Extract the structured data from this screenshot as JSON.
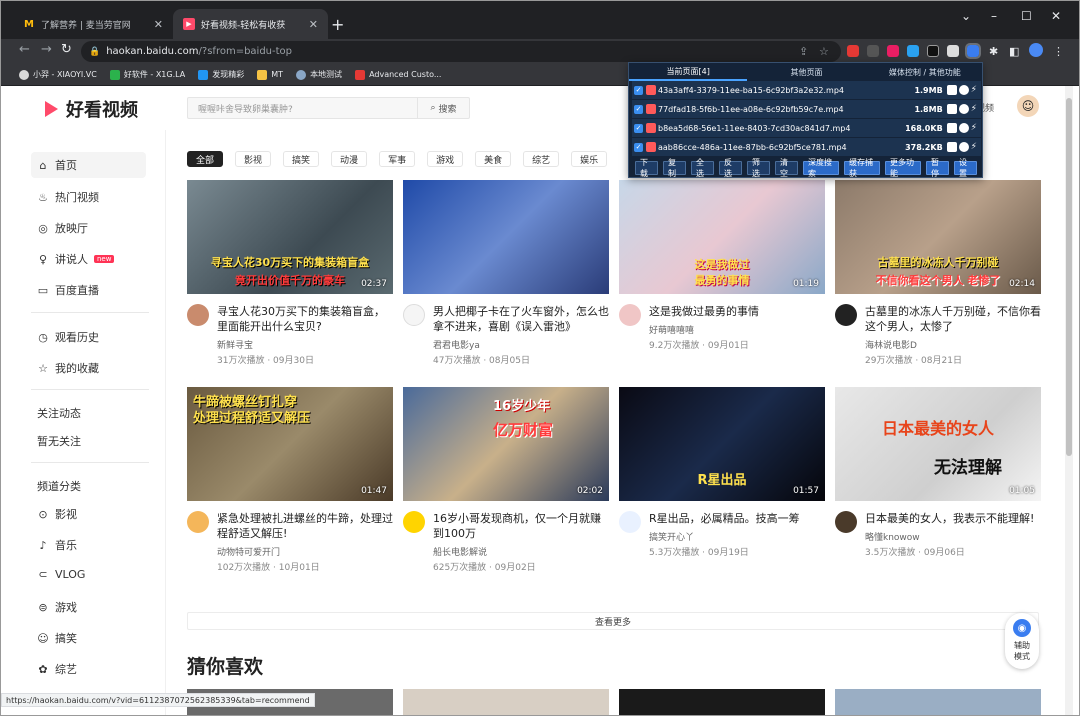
{
  "browser": {
    "tabs": [
      {
        "title": "了解营养 | 麦当劳官网",
        "active": false
      },
      {
        "title": "好看视频-轻松有收获",
        "active": true
      }
    ],
    "url_host": "haokan.baidu.com",
    "url_path": "/?sfrom=baidu-top",
    "bookmarks": [
      "小羿 - XIAOYI.VC",
      "好软件 - X1G.LA",
      "发现精彩",
      "MT",
      "本地测试",
      "Advanced Custo..."
    ]
  },
  "site": {
    "logo_text": "好看视频",
    "search_placeholder": "喔喔咔舍导致卵巢囊肿?",
    "search_button": "搜索",
    "header_video_label": "视频"
  },
  "sidebar": {
    "items": [
      {
        "label": "首页",
        "icon": "home-icon"
      },
      {
        "label": "热门视频",
        "icon": "fire-icon"
      },
      {
        "label": "放映厅",
        "icon": "theater-icon"
      },
      {
        "label": "讲说人",
        "icon": "mic-icon",
        "badge": "new"
      },
      {
        "label": "百度直播",
        "icon": "live-icon"
      },
      {
        "label": "观看历史",
        "icon": "clock-icon"
      },
      {
        "label": "我的收藏",
        "icon": "star-icon"
      },
      {
        "label": "关注动态"
      },
      {
        "label": "暂无关注"
      },
      {
        "label": "频道分类"
      },
      {
        "label": "影视",
        "icon": "play-circle-icon"
      },
      {
        "label": "音乐",
        "icon": "music-icon"
      },
      {
        "label": "VLOG",
        "icon": "vlog-icon"
      },
      {
        "label": "游戏",
        "icon": "gamepad-icon"
      },
      {
        "label": "搞笑",
        "icon": "smile-icon"
      },
      {
        "label": "综艺",
        "icon": "variety-icon"
      }
    ]
  },
  "categories": [
    "全部",
    "影视",
    "搞笑",
    "动漫",
    "军事",
    "游戏",
    "美食",
    "综艺",
    "娱乐"
  ],
  "videos": [
    {
      "title": "寻宝人花30万买下的集装箱盲盒，里面能开出什么宝贝?",
      "author": "新鲜寻宝",
      "meta": "31万次播放 · 09月30日",
      "duration": "02:37",
      "overlay1": "寻宝人花30万买下的集装箱盲盒",
      "overlay2": "竟开出价值千万的豪车"
    },
    {
      "title": "男人把椰子卡在了火车窗外，怎么也拿不进来，喜剧《误入雷池》",
      "author": "君君电影ya",
      "meta": "47万次播放 · 08月05日",
      "duration": "",
      "overlay1": "",
      "overlay2": ""
    },
    {
      "title": "这是我做过最勇的事情",
      "author": "好萌嘻嘻嘻",
      "meta": "9.2万次播放 · 09月01日",
      "duration": "01:19",
      "overlay1": "这是我做过",
      "overlay2": "最勇的事情"
    },
    {
      "title": "古墓里的冰冻人千万别碰，不信你看这个男人，太惨了",
      "author": "海林说电影D",
      "meta": "29万次播放 · 08月21日",
      "duration": "02:14",
      "overlay1": "古墓里的冰冻人千万别碰",
      "overlay2": "不信你看这个男人 老惨了"
    },
    {
      "title": "紧急处理被扎进螺丝的牛蹄，处理过程舒适又解压!",
      "author": "动物特可爱开门",
      "meta": "102万次播放 · 10月01日",
      "duration": "01:47",
      "overlay1": "牛蹄被螺丝钉扎穿",
      "overlay2": "处理过程舒适又解压"
    },
    {
      "title": "16岁小哥发现商机，仅一个月就赚到100万",
      "author": "船长电影解说",
      "meta": "625万次播放 · 09月02日",
      "duration": "02:02",
      "overlay1": "16岁少年",
      "overlay2": "亿万财富"
    },
    {
      "title": "R星出品，必属精品。技高一筹",
      "author": "搞笑开心丫",
      "meta": "5.3万次播放 · 09月19日",
      "duration": "01:57",
      "overlay1": "R星出品",
      "overlay2": ""
    },
    {
      "title": "日本最美的女人，我表示不能理解!",
      "author": "略懂knowow",
      "meta": "3.5万次播放 · 09月06日",
      "duration": "01:05",
      "overlay1": "日本最美的女人",
      "overlay2": "无法理解"
    }
  ],
  "load_more": "查看更多",
  "section_title": "猜你喜欢",
  "assist": {
    "line1": "辅助",
    "line2": "模式"
  },
  "statusbar": "https://haokan.baidu.com/v?vid=6112387072562385339&tab=recommend",
  "extension": {
    "tabs": [
      "当前页面[4]",
      "其他页面",
      "媒体控制 / 其他功能"
    ],
    "files": [
      {
        "name": "43a3aff4-3379-11ee-ba15-6c92bf3a2e32.mp4",
        "size": "1.9MB"
      },
      {
        "name": "77dfad18-5f6b-11ee-a08e-6c92bfb59c7e.mp4",
        "size": "1.8MB"
      },
      {
        "name": "b8ea5d68-56e1-11ee-8403-7cd30ac841d7.mp4",
        "size": "168.0KB"
      },
      {
        "name": "aab86cce-486a-11ee-87bb-6c92bf5ce781.mp4",
        "size": "378.2KB"
      }
    ],
    "buttons": [
      "下载",
      "复制",
      "全选",
      "反选",
      "筛选",
      "清空",
      "深度搜索",
      "缓存捕获",
      "更多功能",
      "暂停",
      "设置"
    ]
  }
}
